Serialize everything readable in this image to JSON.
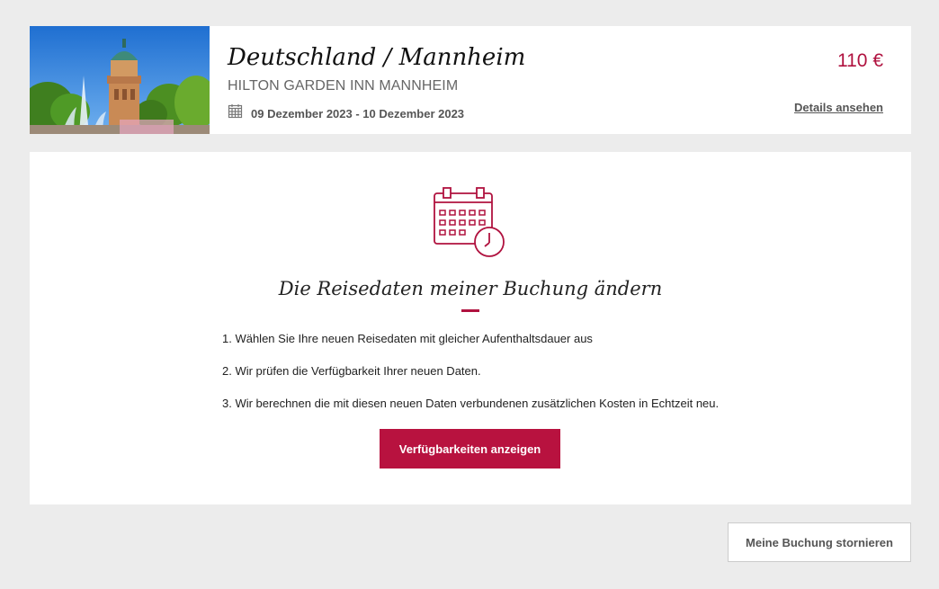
{
  "booking": {
    "destination": "Deutschland / Mannheim",
    "hotel_name": "HILTON GARDEN INN MANNHEIM",
    "dates": "09 Dezember 2023 - 10 Dezember 2023",
    "price": "110 €",
    "details_link": "Details ansehen"
  },
  "change_dates": {
    "title": "Die Reisedaten meiner Buchung ändern",
    "steps": [
      "1. Wählen Sie Ihre neuen Reisedaten mit gleicher Aufenthaltsdauer aus",
      "2. Wir prüfen die Verfügbarkeit Ihrer neuen Daten.",
      "3. Wir berechnen die mit diesen neuen Daten verbundenen zusätzlichen Kosten in Echtzeit neu."
    ],
    "button_label": "Verfügbarkeiten anzeigen"
  },
  "cancel_button_label": "Meine Buchung stornieren",
  "icons": {
    "dates": "calendar-icon",
    "illustration": "calendar-clock-icon"
  },
  "colors": {
    "accent": "#b8123f",
    "background": "#ececec",
    "card": "#ffffff"
  }
}
